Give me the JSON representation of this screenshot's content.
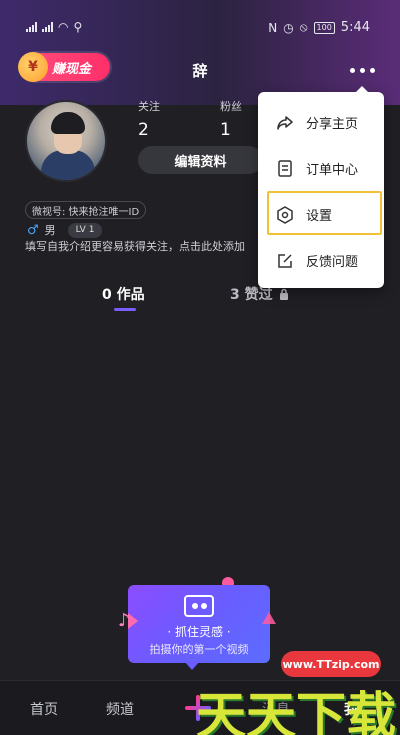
{
  "status_bar": {
    "time": "5:44",
    "battery": "100"
  },
  "header": {
    "earn_badge": "赚现金",
    "username": "辞"
  },
  "profile": {
    "avatar_caption": "",
    "following_label": "关注",
    "following_count": "2",
    "followers_label": "粉丝",
    "followers_count": "1",
    "edit_button": "编辑资料",
    "weishi_id": "微视号: 快来抢注唯一ID",
    "gender_symbol": "♂",
    "gender": "男",
    "level": "LV 1",
    "bio_placeholder": "填写自我介绍更容易获得关注，点击此处添加"
  },
  "tabs": {
    "works": "0 作品",
    "likes": "3 赞过"
  },
  "menu": {
    "items": [
      {
        "label": "分享主页",
        "icon": "share-icon"
      },
      {
        "label": "订单中心",
        "icon": "receipt-icon"
      },
      {
        "label": "设置",
        "icon": "gear-icon"
      },
      {
        "label": "反馈问题",
        "icon": "edit-icon"
      }
    ]
  },
  "promo": {
    "title": "· 抓住灵感 ·",
    "subtitle": "拍摄你的第一个视频"
  },
  "bottom_nav": {
    "home": "首页",
    "channel": "频道",
    "messages": "消息",
    "me": "我"
  },
  "watermark": {
    "url": "www.TTzip.com",
    "text": "天天下载"
  },
  "colors": {
    "accent": "#7a5cff",
    "highlight_border": "#f2c236",
    "earn_badge": "#ff2f6a"
  }
}
